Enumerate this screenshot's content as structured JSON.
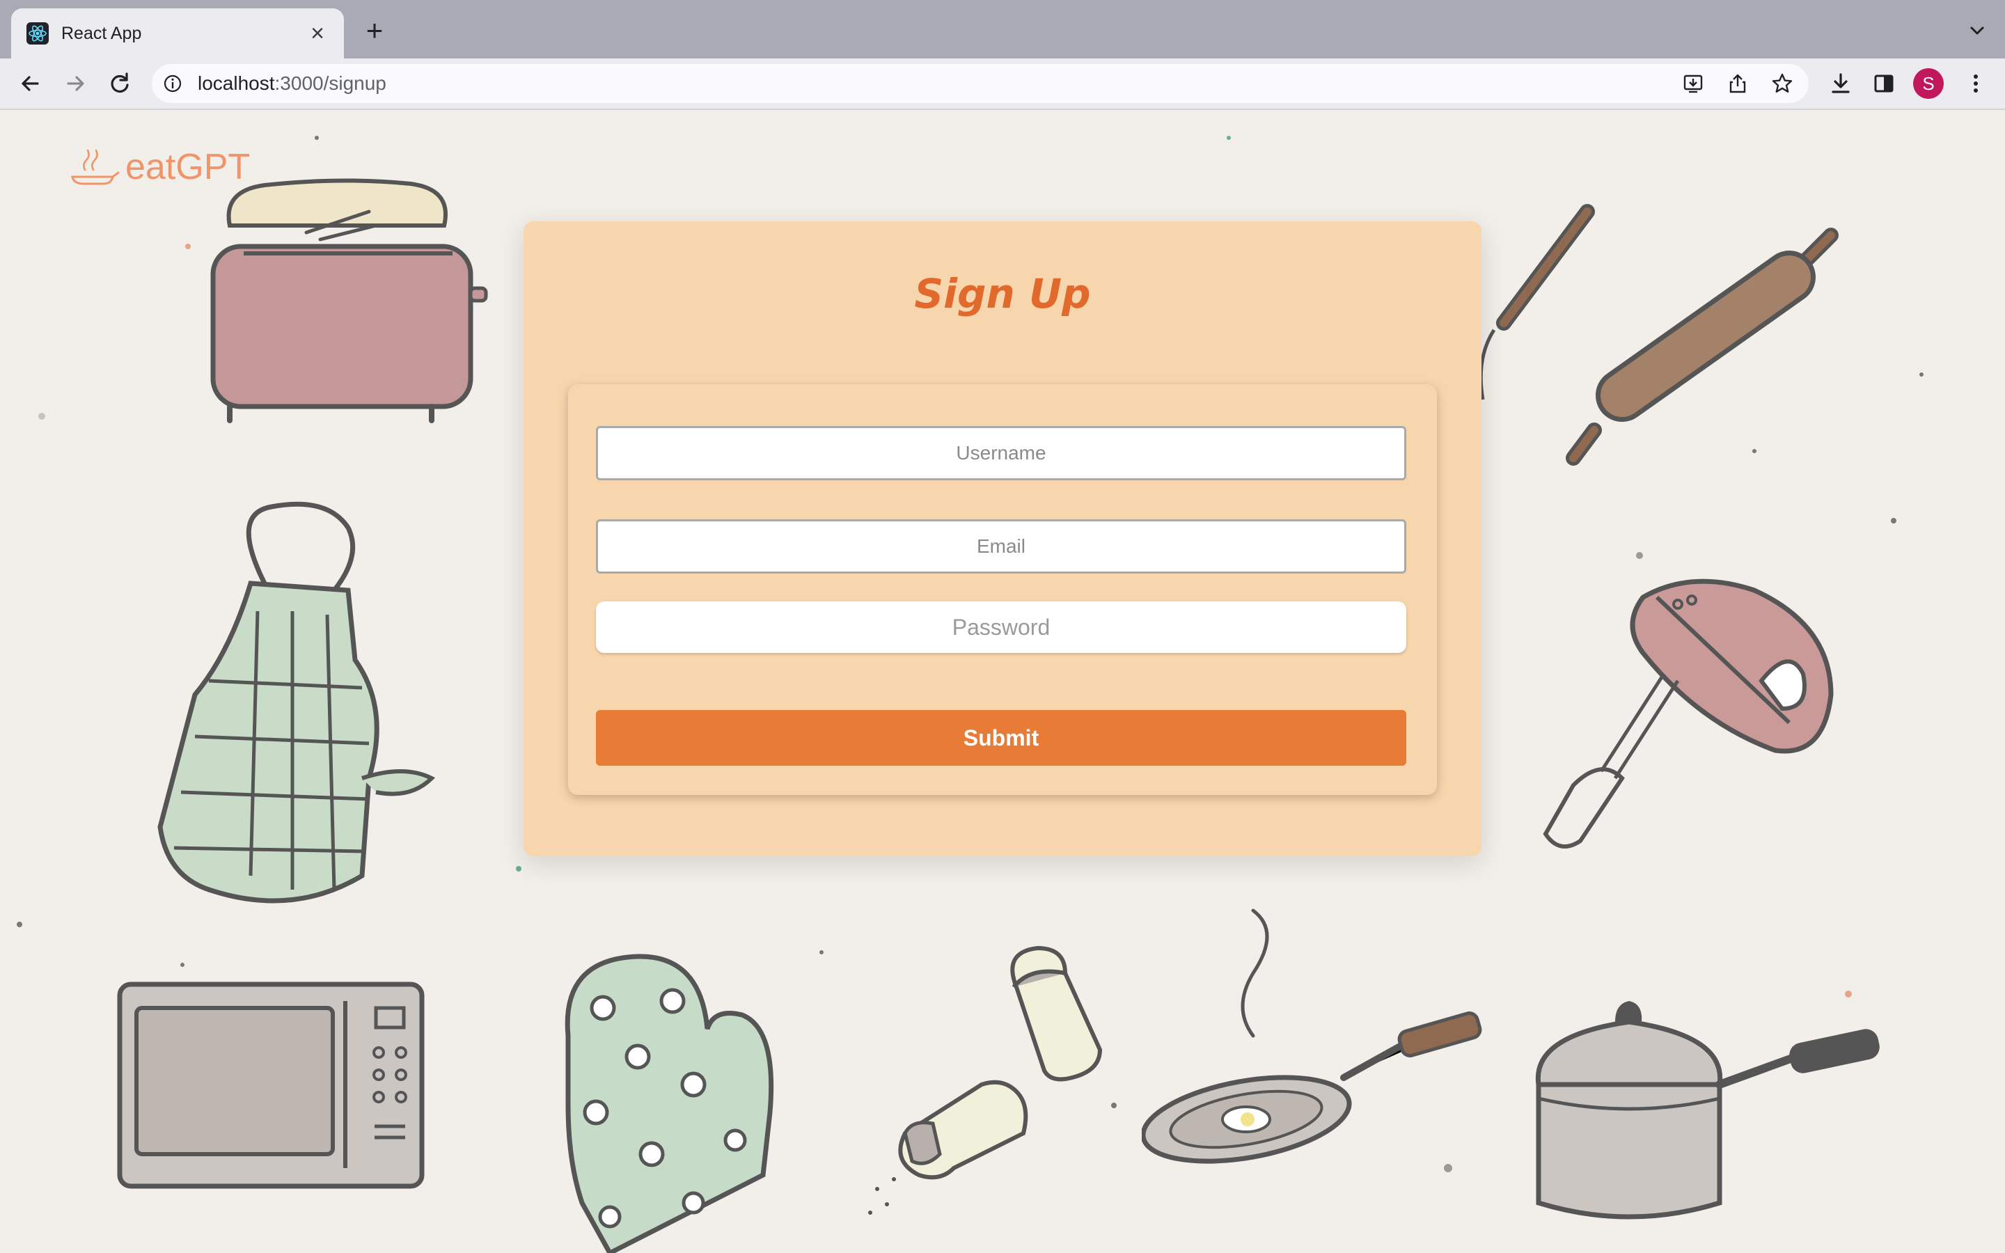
{
  "browser": {
    "tab_title": "React App",
    "url_host": "localhost",
    "url_path": ":3000/signup",
    "profile_initial": "S"
  },
  "app": {
    "logo_text": "eatGPT"
  },
  "signup": {
    "title": "Sign Up",
    "username_placeholder": "Username",
    "email_placeholder": "Email",
    "password_placeholder": "Password",
    "submit_label": "Submit"
  },
  "colors": {
    "card_bg": "#f8d6ad",
    "accent": "#e87b35",
    "title": "#e0692b",
    "page_bg": "#f2efea"
  },
  "icons": [
    "react-icon",
    "close-icon",
    "plus-icon",
    "chevron-down-icon",
    "back-arrow-icon",
    "forward-arrow-icon",
    "reload-icon",
    "info-icon",
    "install-icon",
    "share-icon",
    "star-icon",
    "download-icon",
    "sidebar-icon",
    "more-vert-icon",
    "pan-logo-icon"
  ]
}
